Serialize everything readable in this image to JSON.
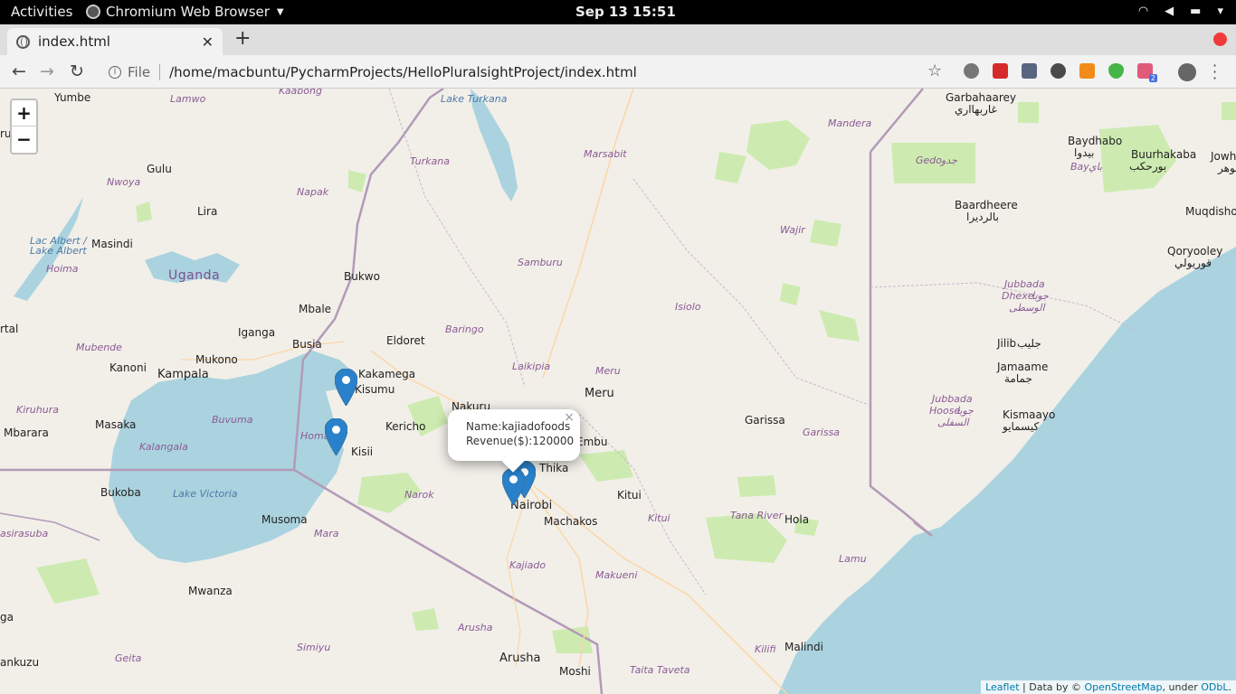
{
  "topbar": {
    "activities": "Activities",
    "app_name": "Chromium Web Browser",
    "clock": "Sep 13  15:51"
  },
  "tab": {
    "title": "index.html"
  },
  "omnibox": {
    "scheme": "File",
    "url": "/home/macbuntu/PycharmProjects/HelloPluralsightProject/index.html"
  },
  "extensions": {
    "badge": "2"
  },
  "map": {
    "zoom_in": "+",
    "zoom_out": "−",
    "labels": {
      "yumbe": "Yumbe",
      "lamwo": "Lamwo",
      "kaabong": "Kaabong",
      "lake_turkana": "Lake Turkana",
      "garbahaarey": "Garbahaarey",
      "garbahaarey_ar": "غاربهااري",
      "mandera": "Mandera",
      "aru": "rua",
      "gulu": "Gulu",
      "turkana": "Turkana",
      "marsabit": "Marsabit",
      "baydhabo": "Baydhabo",
      "baydhabo_ar": "بيدوا",
      "buurhakaba": "Buurhakaba",
      "buurhakaba_ar": "بورحكب",
      "bay": "Bay",
      "bay_ar": "باي",
      "jowha": "Jowha",
      "jowha_ar": "جوهر",
      "gedo": "Gedo",
      "gedo_ar": "جدو",
      "nwoya": "Nwoya",
      "napak": "Napak",
      "baardheere": "Baardheere",
      "baardheere_ar": "بالرديرا",
      "muqdisho": "Muqdisho",
      "lira": "Lira",
      "lac_albert": "Lac Albert /",
      "lake_albert": "Lake Albert",
      "masindi": "Masindi",
      "wajir": "Wajir",
      "qoryooley": "Qoryooley",
      "qoryooley_ar": "قوريولي",
      "hoima": "Hoima",
      "uganda": "Uganda",
      "samburu": "Samburu",
      "bukwo": "Bukwo",
      "jubbada_dhexe": "Jubbada",
      "jubbada_dhexe2": "Dhexe",
      "jubbada_dhexe_ar": "جوبا",
      "jubbada_dhexe_ar2": "الوسطى",
      "mbale": "Mbale",
      "isiolo": "Isiolo",
      "ortal": "rtal",
      "iganga": "Iganga",
      "busia": "Busia",
      "baringo": "Baringo",
      "eldoret": "Eldoret",
      "jilib": "Jilib",
      "jilib_ar": "جليب",
      "mubende": "Mubende",
      "mukono": "Mukono",
      "kanoni": "Kanoni",
      "kampala": "Kampala",
      "kakamega": "Kakamega",
      "laikipia": "Laikipia",
      "meru_region": "Meru",
      "jamaame": "Jamaame",
      "jamaame_ar": "جمامة",
      "kisumu": "Kisumu",
      "meru": "Meru",
      "jubbada_hoose": "Jubbada",
      "jubbada_hoose2": "Hoose",
      "jubbada_hoose_ar": "جوبا",
      "jubbada_hoose_ar2": "السفلى",
      "kiruhura": "Kiruhura",
      "nakuru": "Nakuru",
      "buvuma": "Buvuma",
      "garissa": "Garissa",
      "kisumu_bay": "Homa",
      "kericho": "Kericho",
      "kismaayo": "Kismaayo",
      "kismaayo_ar": "كيسمايو",
      "masaka": "Masaka",
      "mbarara": "Mbarara",
      "embu": "Embu",
      "garissa_region": "Garissa",
      "kalangala": "Kalangala",
      "kisii": "Kisii",
      "thika": "Thika",
      "bukoba": "Bukoba",
      "lake_victoria": "Lake Victoria",
      "narok": "Narok",
      "kitui": "Kitui",
      "nairobi": "Nairobi",
      "tana_river": "Tana River",
      "hola": "Hola",
      "musoma": "Musoma",
      "machakos": "Machakos",
      "kitui_region": "Kitui",
      "karasuba": "asirasuba",
      "mara": "Mara",
      "lamu": "Lamu",
      "kajiado": "Kajiado",
      "makueni": "Makueni",
      "mwanza": "Mwanza",
      "ga": "ga",
      "arusha_region": "Arusha",
      "simiyu": "Simiyu",
      "kilifi": "Kilifi",
      "malindi": "Malindi",
      "geita": "Geita",
      "arusha": "Arusha",
      "moshi": "Moshi",
      "taita_taveta": "Taita Taveta",
      "ankuzu": "ankuzu"
    },
    "popup": {
      "name_line": "Name:kajiadofoods",
      "revenue_line": "Revenue($):120000",
      "close": "×"
    },
    "attribution": {
      "leaflet": "Leaflet",
      "data_by": " | Data by © ",
      "osm": "OpenStreetMap",
      "under": ", under ",
      "odbl": "ODbL",
      "end": "."
    }
  },
  "colors": {
    "land": "#f2efe9",
    "water": "#aad3df",
    "park": "#cdebb0",
    "border": "#b39ab8",
    "marker": "#2a81cb"
  }
}
